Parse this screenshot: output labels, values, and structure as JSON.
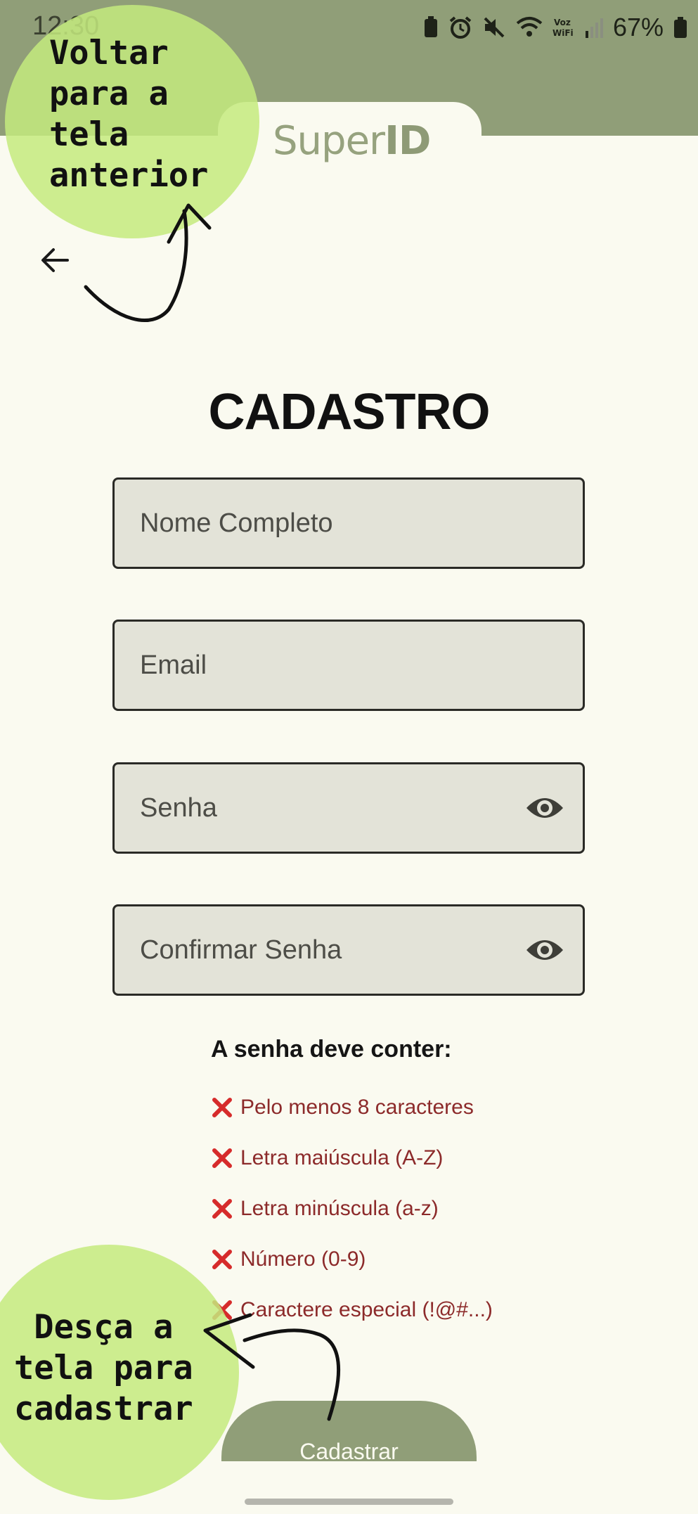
{
  "status_bar": {
    "time": "12:30",
    "battery_percent": "67%"
  },
  "app": {
    "logo_part1": "Super",
    "logo_part2": "ID"
  },
  "page": {
    "title": "CADASTRO"
  },
  "form": {
    "name_placeholder": "Nome Completo",
    "email_placeholder": "Email",
    "password_placeholder": "Senha",
    "confirm_placeholder": "Confirmar Senha"
  },
  "requirements": {
    "heading": "A senha deve conter:",
    "items": [
      "Pelo menos 8 caracteres",
      "Letra maiúscula (A-Z)",
      "Letra minúscula (a-z)",
      "Número (0-9)",
      "Caractere especial (!@#...)"
    ]
  },
  "actions": {
    "register_label": "Cadastrar"
  },
  "annotations": {
    "back_hint": "Voltar\npara a\ntela\nanterior",
    "scroll_hint": "Desça a\ntela para\ncadastrar"
  },
  "colors": {
    "brand_green": "#909e78",
    "background": "#fafaf0",
    "error_red": "#d62b2b",
    "annotation_green": "#c4ea7e"
  },
  "icons": [
    "back-arrow-icon",
    "eye-icon",
    "x-icon",
    "battery-icon",
    "wifi-icon",
    "alarm-icon",
    "mute-icon",
    "signal-icon"
  ]
}
